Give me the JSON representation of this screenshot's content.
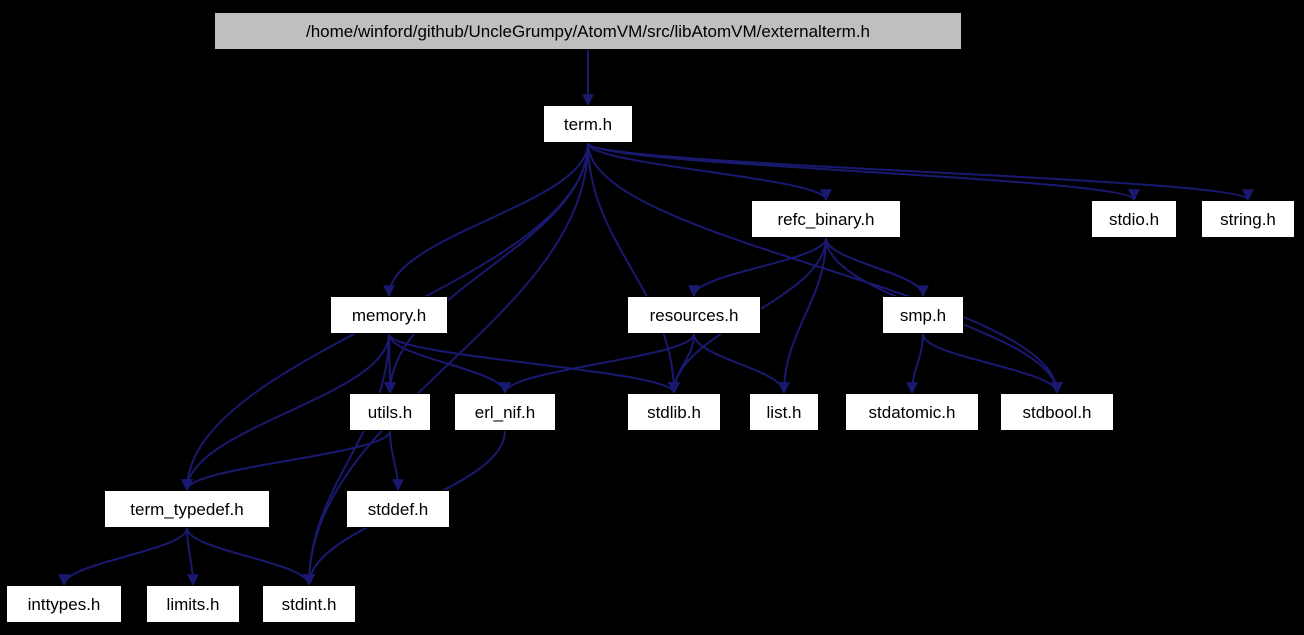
{
  "nodes": {
    "root": {
      "label": "/home/winford/github/UncleGrumpy/AtomVM/src/libAtomVM/externalterm.h"
    },
    "term": {
      "label": "term.h"
    },
    "refc": {
      "label": "refc_binary.h"
    },
    "stdio": {
      "label": "stdio.h"
    },
    "string": {
      "label": "string.h"
    },
    "memory": {
      "label": "memory.h"
    },
    "resources": {
      "label": "resources.h"
    },
    "smp": {
      "label": "smp.h"
    },
    "utils": {
      "label": "utils.h"
    },
    "erlnif": {
      "label": "erl_nif.h"
    },
    "stdlib": {
      "label": "stdlib.h"
    },
    "list": {
      "label": "list.h"
    },
    "stdatomic": {
      "label": "stdatomic.h"
    },
    "stdbool": {
      "label": "stdbool.h"
    },
    "termtd": {
      "label": "term_typedef.h"
    },
    "stddef": {
      "label": "stddef.h"
    },
    "inttypes": {
      "label": "inttypes.h"
    },
    "limits": {
      "label": "limits.h"
    },
    "stdint": {
      "label": "stdint.h"
    }
  },
  "edges": [
    [
      "root",
      "term"
    ],
    [
      "term",
      "refc"
    ],
    [
      "term",
      "stdio"
    ],
    [
      "term",
      "string"
    ],
    [
      "term",
      "memory"
    ],
    [
      "term",
      "utils"
    ],
    [
      "term",
      "stdlib"
    ],
    [
      "term",
      "stdbool"
    ],
    [
      "term",
      "stdint"
    ],
    [
      "term",
      "termtd"
    ],
    [
      "refc",
      "resources"
    ],
    [
      "refc",
      "smp"
    ],
    [
      "refc",
      "stdlib"
    ],
    [
      "refc",
      "list"
    ],
    [
      "refc",
      "stdbool"
    ],
    [
      "memory",
      "utils"
    ],
    [
      "memory",
      "erlnif"
    ],
    [
      "memory",
      "termtd"
    ],
    [
      "memory",
      "stdlib"
    ],
    [
      "memory",
      "stdint"
    ],
    [
      "resources",
      "stdlib"
    ],
    [
      "resources",
      "list"
    ],
    [
      "resources",
      "erlnif"
    ],
    [
      "smp",
      "stdatomic"
    ],
    [
      "smp",
      "stdbool"
    ],
    [
      "utils",
      "stddef"
    ],
    [
      "utils",
      "termtd"
    ],
    [
      "erlnif",
      "stdint"
    ],
    [
      "termtd",
      "inttypes"
    ],
    [
      "termtd",
      "limits"
    ],
    [
      "termtd",
      "stdint"
    ]
  ]
}
